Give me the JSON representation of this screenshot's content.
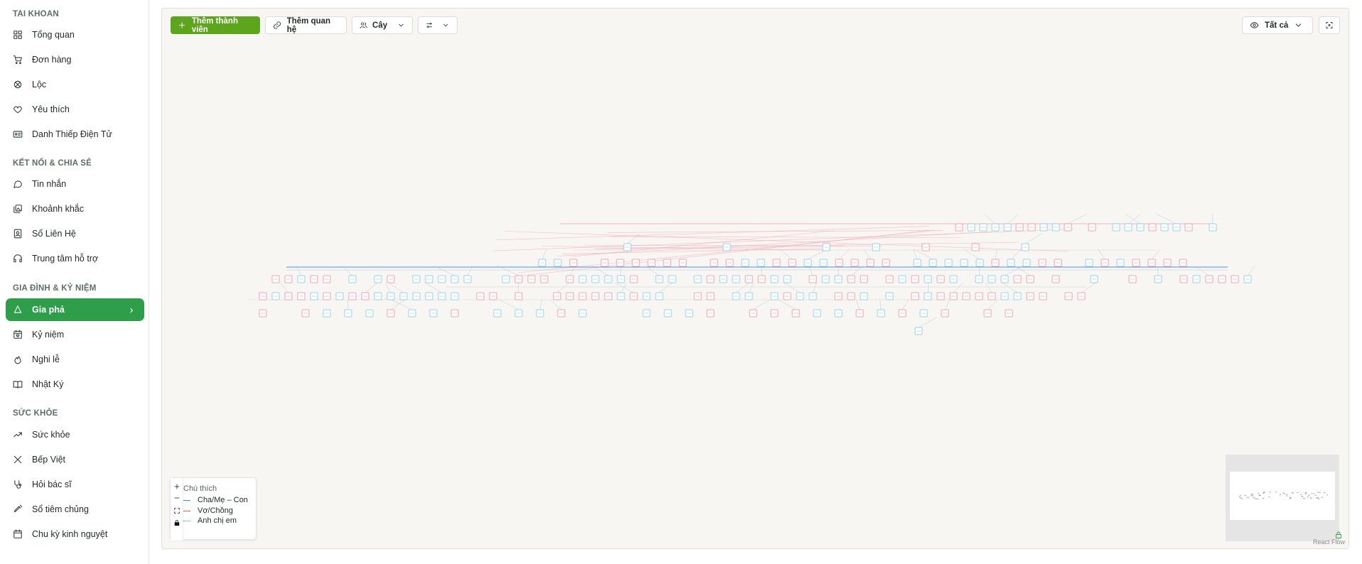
{
  "sidebar": {
    "sections": [
      {
        "title": "TAI KHOAN",
        "items": [
          {
            "label": "Tổng quan",
            "icon": "grid-icon"
          },
          {
            "label": "Đơn hàng",
            "icon": "cart-icon"
          },
          {
            "label": "Lộc",
            "icon": "gift-icon"
          },
          {
            "label": "Yêu thích",
            "icon": "heart-icon"
          },
          {
            "label": "Danh Thiếp Điện Tử",
            "icon": "id-card-icon"
          }
        ]
      },
      {
        "title": "KẾT NỐI & CHIA SẺ",
        "items": [
          {
            "label": "Tin nhắn",
            "icon": "chat-icon"
          },
          {
            "label": "Khoảnh khắc",
            "icon": "gallery-icon"
          },
          {
            "label": "Sổ Liên Hệ",
            "icon": "contacts-icon"
          },
          {
            "label": "Trung tâm hỗ trợ",
            "icon": "headset-icon"
          }
        ]
      },
      {
        "title": "GIA ĐÌNH & KỶ NIỆM",
        "items": [
          {
            "label": "Gia phả",
            "icon": "tree-icon",
            "active": true
          },
          {
            "label": "Kỷ niệm",
            "icon": "calendar-heart-icon"
          },
          {
            "label": "Nghi lễ",
            "icon": "flame-icon"
          },
          {
            "label": "Nhật Ký",
            "icon": "book-icon"
          }
        ]
      },
      {
        "title": "SỨC KHỎE",
        "items": [
          {
            "label": "Sức khỏe",
            "icon": "trend-icon"
          },
          {
            "label": "Bếp Việt",
            "icon": "utensils-icon"
          },
          {
            "label": "Hỏi bác sĩ",
            "icon": "stethoscope-icon"
          },
          {
            "label": "Sổ tiêm chủng",
            "icon": "syringe-icon"
          },
          {
            "label": "Chu kỳ kinh nguyệt",
            "icon": "calendar-icon"
          }
        ]
      }
    ]
  },
  "toolbar": {
    "add_member": "Thêm thành viên",
    "add_relation": "Thêm quan hệ",
    "view_mode": "Cây",
    "filter_label": "Tất cả"
  },
  "legend": {
    "title": "Chú thích",
    "parent_child": "Cha/Mẹ – Con",
    "spouse": "Vợ/Chồng",
    "sibling": "Anh chị em",
    "colors": {
      "parent_child": "#3b82f6",
      "spouse": "#ef4444",
      "sibling": "#22c55e"
    }
  },
  "minimap": {
    "attribution": "React Flow"
  },
  "colors": {
    "accent": "#2e9e4b",
    "primary_button": "#5ea51e",
    "male_node": "#7cc7e8",
    "female_node": "#f08a9a",
    "canvas": "#f8f6f2"
  }
}
